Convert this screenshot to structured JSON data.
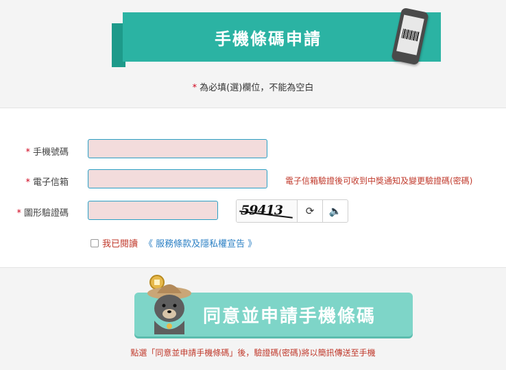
{
  "header": {
    "title": "手機條碼申請"
  },
  "required_note": {
    "star": "*",
    "text": "為必填(選)欄位，不能為空白"
  },
  "form": {
    "phone": {
      "star": "*",
      "label": "手機號碼",
      "value": ""
    },
    "email": {
      "star": "*",
      "label": "電子信箱",
      "value": "",
      "hint": "電子信箱驗證後可收到中獎通知及變更驗證碼(密碼)"
    },
    "captcha": {
      "star": "*",
      "label": "圖形驗證碼",
      "value": "",
      "image_text": "59413",
      "refresh_icon": "refresh-icon",
      "audio_icon": "speaker-icon"
    },
    "agree": {
      "text": "我已閱讀",
      "link": "《 服務條款及隱私權宣告 》"
    }
  },
  "submit": {
    "label": "同意並申請手機條碼"
  },
  "bottom_note": "點選「同意並申請手機條碼」後，驗證碼(密碼)將以簡訊傳送至手機",
  "colors": {
    "accent": "#2bb3a3",
    "submit": "#7ed5c8",
    "input_bg": "#f3dcdc",
    "required": "#d0021b"
  }
}
